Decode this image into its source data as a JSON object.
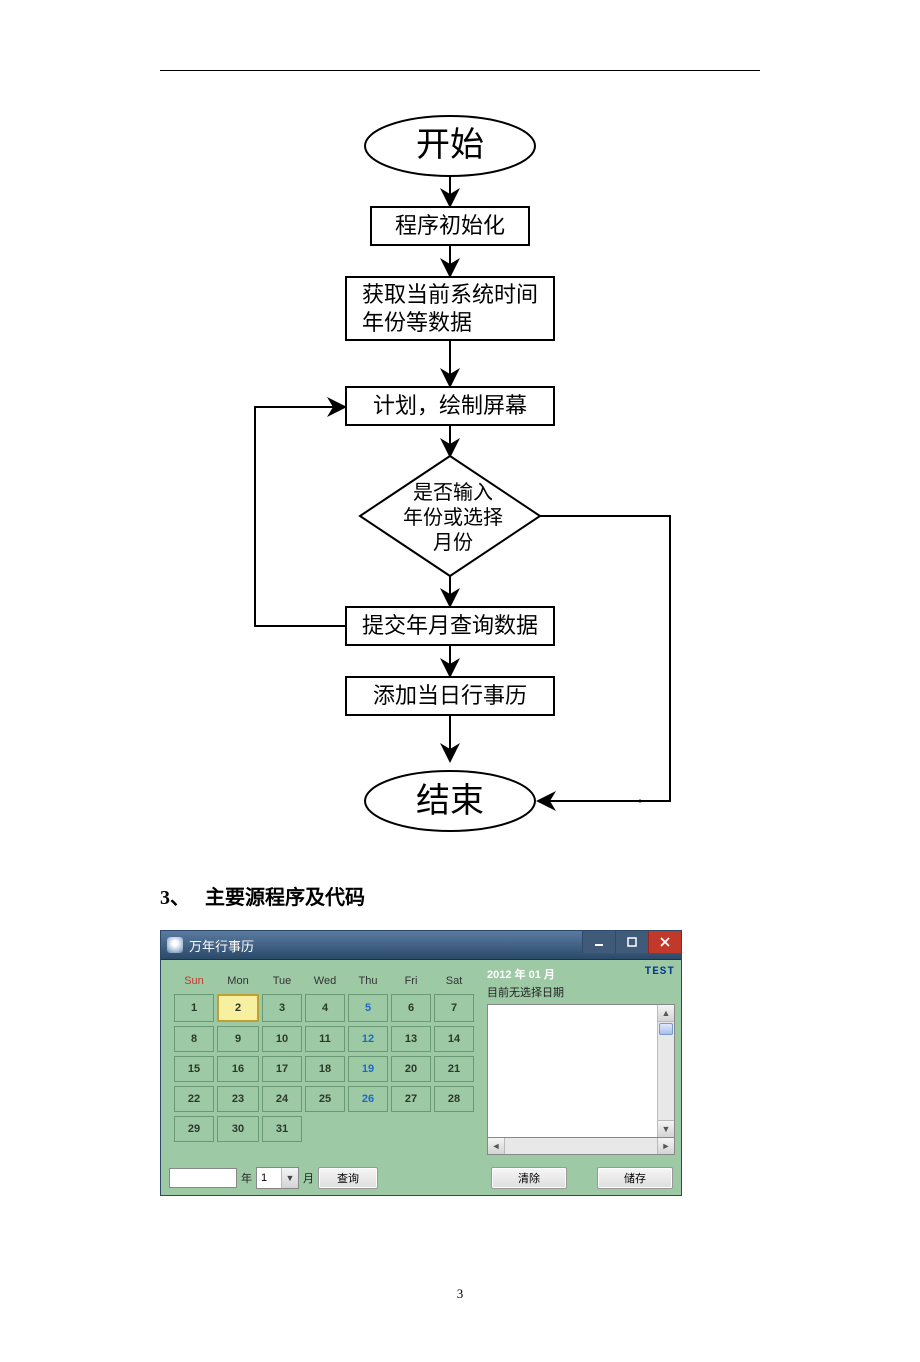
{
  "flow": {
    "start": "开始",
    "init": "程序初始化",
    "gettime": "获取当前系统时间\n年份等数据",
    "plan": "计划，绘制屏幕",
    "decision": "是否输入\n年份或选择\n月份",
    "submit": "提交年月查询数据",
    "addcal": "添加当日行事历",
    "end": "结束"
  },
  "section": {
    "num": "3、",
    "title": "主要源程序及代码"
  },
  "app": {
    "title": "万年行事历",
    "weekdays": [
      "Sun",
      "Mon",
      "Tue",
      "Wed",
      "Thu",
      "Fri",
      "Sat"
    ],
    "days": [
      [
        1,
        2,
        3,
        4,
        5,
        6,
        7
      ],
      [
        8,
        9,
        10,
        11,
        12,
        13,
        14
      ],
      [
        15,
        16,
        17,
        18,
        19,
        20,
        21
      ],
      [
        22,
        23,
        24,
        25,
        26,
        27,
        28
      ],
      [
        29,
        30,
        31,
        null,
        null,
        null,
        null
      ]
    ],
    "selected_day": 2,
    "highlight_col": 4,
    "date_label": "2012 年 01 月",
    "test_label": "TEST",
    "status": "目前无选择日期",
    "year_label": "年",
    "month_label": "月",
    "month_value": "1",
    "query_btn": "查询",
    "clear_btn": "清除",
    "save_btn": "储存"
  },
  "page_number": "3"
}
